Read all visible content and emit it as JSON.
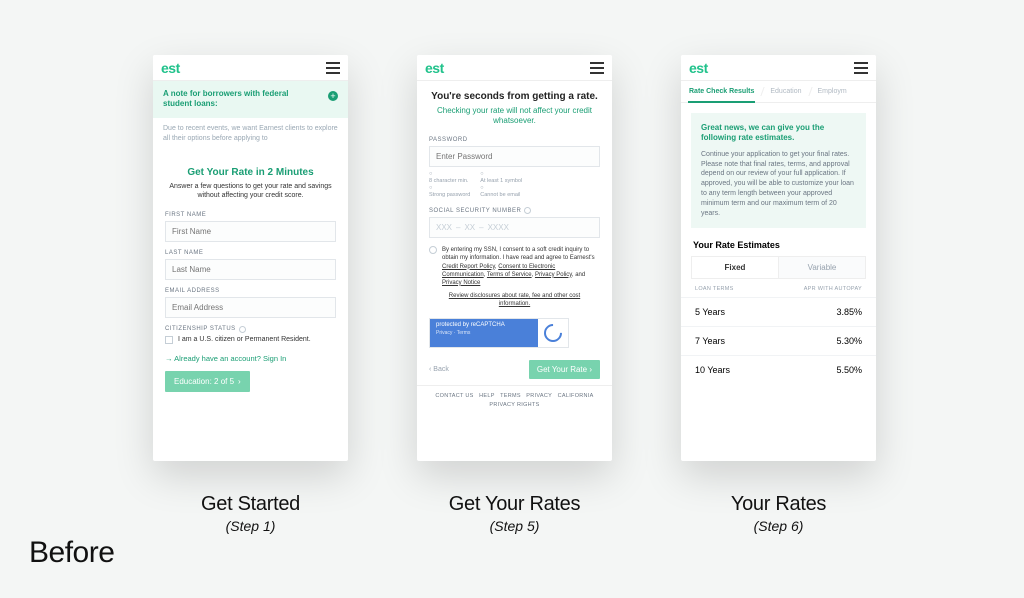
{
  "brand_logo_text": "est",
  "captions": {
    "c1_title": "Get Started",
    "c1_step": "(Step 1)",
    "c2_title": "Get Your Rates",
    "c2_step": "(Step 5)",
    "c3_title": "Your Rates",
    "c3_step": "(Step 6)"
  },
  "before_label": "Before",
  "screen1": {
    "banner_title": "A note for borrowers with federal student loans:",
    "banner_body": "Due to recent events, we want Earnest clients to explore all their options before applying to",
    "form_title": "Get Your Rate in 2 Minutes",
    "form_sub": "Answer a few questions to get your rate and savings without affecting your credit score.",
    "labels": {
      "first": "FIRST NAME",
      "last": "LAST NAME",
      "email": "EMAIL ADDRESS",
      "citizen": "CITIZENSHIP STATUS"
    },
    "placeholders": {
      "first": "First Name",
      "last": "Last Name",
      "email": "Email Address"
    },
    "citizen_text": "I am a U.S. citizen or Permanent Resident.",
    "already": "→ Already have an account? Sign In",
    "step_btn": "Education: 2 of 5"
  },
  "screen2": {
    "headline": "You're seconds from getting a rate.",
    "green_sub": "Checking your rate will not affect your credit whatsoever.",
    "pw_label": "PASSWORD",
    "pw_ph": "Enter Password",
    "pw_notes": {
      "a1": "8 character min.",
      "a2": "Strong password",
      "b1": "At least 1 symbol",
      "b2": "Cannot be email"
    },
    "ssn_label": "SOCIAL SECURITY NUMBER",
    "ssn_ph": {
      "a": "XXX",
      "b": "XX",
      "c": "XXXX"
    },
    "consent": "By entering my SSN, I consent to a soft credit inquiry to obtain my information. I have read and agree to Earnest's ",
    "links": {
      "crp": "Credit Report Policy",
      "cec": "Consent to Electronic Communication",
      "tos": "Terms of Service",
      "pp": "Privacy Policy",
      "pn": "Privacy Notice"
    },
    "and": ", and ",
    "comma": ", ",
    "review": "Review disclosures about rate, fee and other cost information.",
    "captcha_top": "protected by reCAPTCHA",
    "captcha_bottom": "Privacy · Terms",
    "back": "‹  Back",
    "submit": "Get Your Rate  ›",
    "footer": {
      "contact": "CONTACT US",
      "help": "HELP",
      "terms": "TERMS",
      "privacy": "PRIVACY",
      "cpr": "CALIFORNIA PRIVACY RIGHTS"
    }
  },
  "screen3": {
    "tabs": {
      "t1": "Rate Check Results",
      "t2": "Education",
      "t3": "Employm"
    },
    "great_title": "Great news, we can give you the following rate estimates.",
    "great_body": "Continue your application to get your final rates. Please note that final rates, terms, and approval depend on our review of your full application. If approved, you will be able to customize your loan to any term length between your approved minimum term and our maximum term of 20 years.",
    "est_title": "Your Rate Estimates",
    "fv": {
      "fixed": "Fixed",
      "variable": "Variable"
    },
    "thead": {
      "terms": "LOAN TERMS",
      "apr": "APR WITH AUTOPAY"
    },
    "rows": [
      {
        "term": "5 Years",
        "apr": "3.85%"
      },
      {
        "term": "7 Years",
        "apr": "5.30%"
      },
      {
        "term": "10 Years",
        "apr": "5.50%"
      }
    ]
  }
}
